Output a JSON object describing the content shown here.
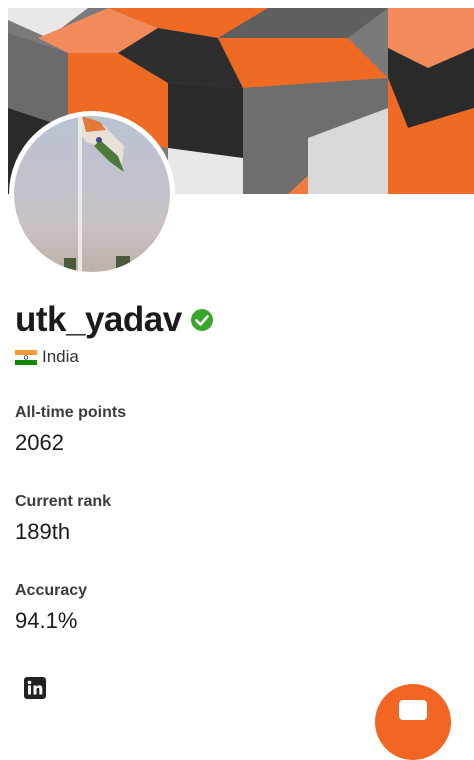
{
  "profile": {
    "username": "utk_yadav",
    "verified": true,
    "country": "India",
    "country_flag": "india-flag-icon"
  },
  "stats": [
    {
      "label": "All-time points",
      "value": "2062"
    },
    {
      "label": "Current rank",
      "value": "189th"
    },
    {
      "label": "Accuracy",
      "value": "94.1%"
    }
  ],
  "social": {
    "linkedin_icon": "linkedin-icon"
  },
  "colors": {
    "accent": "#f26522",
    "verified": "#3aa52b",
    "text": "#1a1a1a"
  }
}
